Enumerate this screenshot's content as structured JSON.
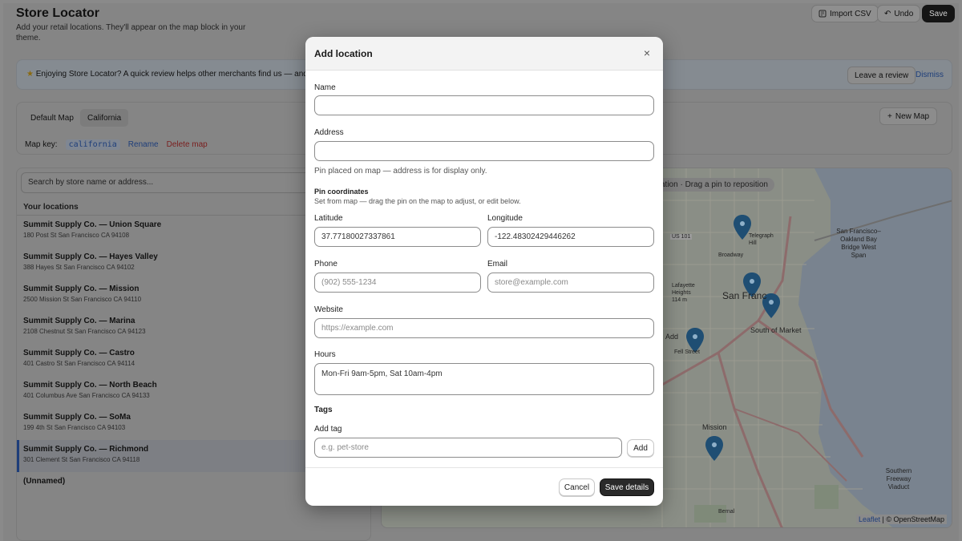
{
  "header": {
    "title": "Store Locator",
    "subtitle": "Add your retail locations. They'll appear on the map block in your theme.",
    "import_label": "Import CSV",
    "undo_label": "Undo",
    "save_label": "Save"
  },
  "banner": {
    "text": "Enjoying Store Locator? A quick review helps other merchants find us — and takes",
    "leave_review_label": "Leave a review",
    "dismiss_label": "Dismiss"
  },
  "maps": {
    "tabs": [
      {
        "label": "Default Map",
        "active": false
      },
      {
        "label": "California",
        "active": true
      }
    ],
    "new_map_label": "New Map",
    "map_key_label": "Map key:",
    "map_key_value": "california",
    "rename_label": "Rename",
    "delete_label": "Delete map"
  },
  "list": {
    "search_placeholder": "Search by store name or address...",
    "heading": "Your locations",
    "items": [
      {
        "name": "Summit Supply Co. — Union Square",
        "address": "180 Post St San Francisco CA 94108"
      },
      {
        "name": "Summit Supply Co. — Hayes Valley",
        "address": "388 Hayes St San Francisco CA 94102"
      },
      {
        "name": "Summit Supply Co. — Mission",
        "address": "2500 Mission St San Francisco CA 94110"
      },
      {
        "name": "Summit Supply Co. — Marina",
        "address": "2108 Chestnut St San Francisco CA 94123"
      },
      {
        "name": "Summit Supply Co. — Castro",
        "address": "401 Castro St San Francisco CA 94114"
      },
      {
        "name": "Summit Supply Co. — North Beach",
        "address": "401 Columbus Ave San Francisco CA 94133"
      },
      {
        "name": "Summit Supply Co. — SoMa",
        "address": "199 4th St San Francisco CA 94103"
      },
      {
        "name": "Summit Supply Co. — Richmond",
        "address": "301 Clement St San Francisco CA 94118"
      },
      {
        "name": "(Unnamed)",
        "address": ""
      }
    ],
    "active_index": 7
  },
  "map": {
    "hint": "ation · Drag a pin to reposition",
    "labels": {
      "sf": "San Franc",
      "bridge": "San Francisco–Oakland Bay Bridge West Span",
      "som": "South of Market",
      "mission": "Mission",
      "us101": "US 101",
      "telegraph": "Telegraph Hill",
      "southern": "Southern Freeway Viaduct",
      "bernal": "Bernal",
      "lafayette": "Lafayette Heights 114 m",
      "fellst": "Fell Street",
      "adn": "Add",
      "broadway": "Broadway"
    },
    "attribution_link": "Leaflet",
    "attribution_text": "| © OpenStreetMap",
    "pin_color": "#1f4e73"
  },
  "modal": {
    "title": "Add location",
    "name_label": "Name",
    "name_value": "",
    "address_label": "Address",
    "address_value": "",
    "address_hint": "Pin placed on map — address is for display only.",
    "coords_heading": "Pin coordinates",
    "coords_hint": "Set from map — drag the pin on the map to adjust, or edit below.",
    "latitude_label": "Latitude",
    "latitude_value": "37.77180027337861",
    "longitude_label": "Longitude",
    "longitude_value": "-122.48302429446262",
    "phone_label": "Phone",
    "phone_placeholder": "(902) 555-1234",
    "email_label": "Email",
    "email_placeholder": "store@example.com",
    "website_label": "Website",
    "website_placeholder": "https://example.com",
    "hours_label": "Hours",
    "hours_value": "Mon-Fri 9am-5pm, Sat 10am-4pm",
    "tags_heading": "Tags",
    "add_tag_label": "Add tag",
    "tag_placeholder": "e.g. pet-store",
    "add_button_label": "Add",
    "cancel_label": "Cancel",
    "save_label": "Save details"
  }
}
